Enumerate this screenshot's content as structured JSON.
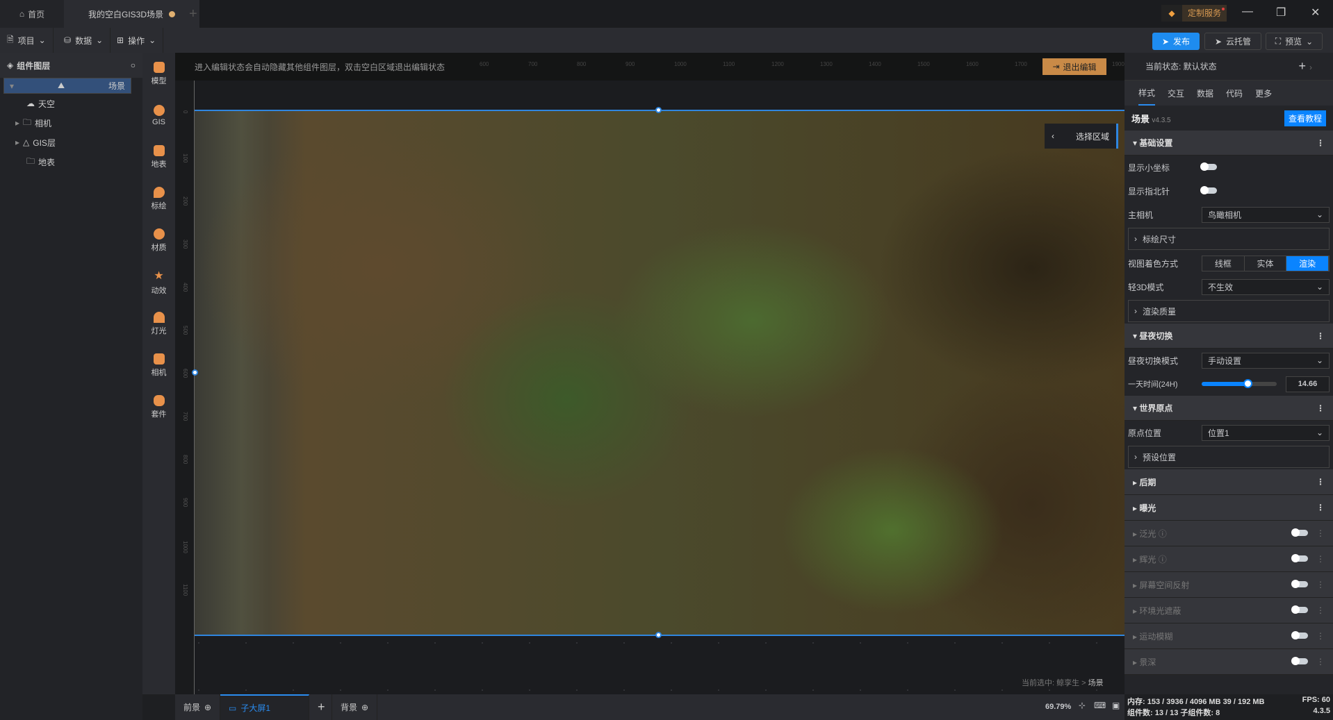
{
  "titlebar": {
    "home": "首页",
    "scene_tab": "我的空白GIS3D场景",
    "custom_service": "定制服务"
  },
  "toolbar": {
    "project": "项目",
    "data": "数据",
    "operate": "操作",
    "publish": "发布",
    "cloud": "云托管",
    "preview": "预览"
  },
  "layers": {
    "title": "组件图层",
    "items": [
      {
        "label": "场景"
      },
      {
        "label": "天空"
      },
      {
        "label": "相机"
      },
      {
        "label": "GIS层"
      },
      {
        "label": "地表"
      }
    ]
  },
  "palette": [
    "模型",
    "GIS",
    "地表",
    "标绘",
    "材质",
    "动效",
    "灯光",
    "相机",
    "套件"
  ],
  "canvas": {
    "hint": "进入编辑状态会自动隐藏其他组件图层，双击空白区域退出编辑状态",
    "exit_edit": "退出编辑",
    "select_area": "选择区域",
    "crumb_prefix": "当前选中: 鲸孪生 >",
    "crumb_current": "场景",
    "zoom": "69.79%",
    "ruler_top": [
      "600",
      "700",
      "800",
      "900",
      "1000",
      "1100",
      "1200",
      "1300",
      "1400",
      "1500",
      "1600",
      "1700",
      "1800",
      "1900"
    ],
    "ruler_left": [
      "0",
      "100",
      "200",
      "300",
      "400",
      "500",
      "600",
      "700",
      "800",
      "900",
      "1000",
      "1100"
    ]
  },
  "bottom_tabs": {
    "front": "前景",
    "child": "子大屏1",
    "back": "背景"
  },
  "right": {
    "state_label": "当前状态: 默认状态",
    "tabs": [
      "样式",
      "交互",
      "数据",
      "代码",
      "更多"
    ],
    "component": "场景",
    "version": "v4.3.5",
    "tutorial": "查看教程",
    "basic": {
      "title": "基础设置",
      "show_axis": "显示小坐标",
      "show_compass": "显示指北针",
      "main_camera": "主相机",
      "main_camera_value": "鸟瞰相机",
      "plot_size": "标绘尺寸",
      "shading": "视图着色方式",
      "shading_options": [
        "线框",
        "实体",
        "渲染"
      ],
      "light3d": "轻3D模式",
      "light3d_value": "不生效",
      "render_quality": "渲染质量"
    },
    "daynight": {
      "title": "昼夜切换",
      "mode": "昼夜切换模式",
      "mode_value": "手动设置",
      "time": "一天时间(24H)",
      "time_value": "14.66",
      "time_fraction": 0.611
    },
    "origin": {
      "title": "世界原点",
      "position": "原点位置",
      "position_value": "位置1",
      "preset": "预设位置"
    },
    "post": "后期",
    "exposure": "曝光",
    "effects": [
      "泛光",
      "辉光",
      "屏幕空间反射",
      "环境光遮蔽",
      "运动模糊",
      "景深"
    ]
  },
  "status": {
    "memory": "内存: 153 / 3936 / 4096 MB  39 / 192 MB",
    "fps": "FPS: 60",
    "components": "组件数: 13 / 13   子组件数: 8",
    "version": "4.3.5"
  }
}
